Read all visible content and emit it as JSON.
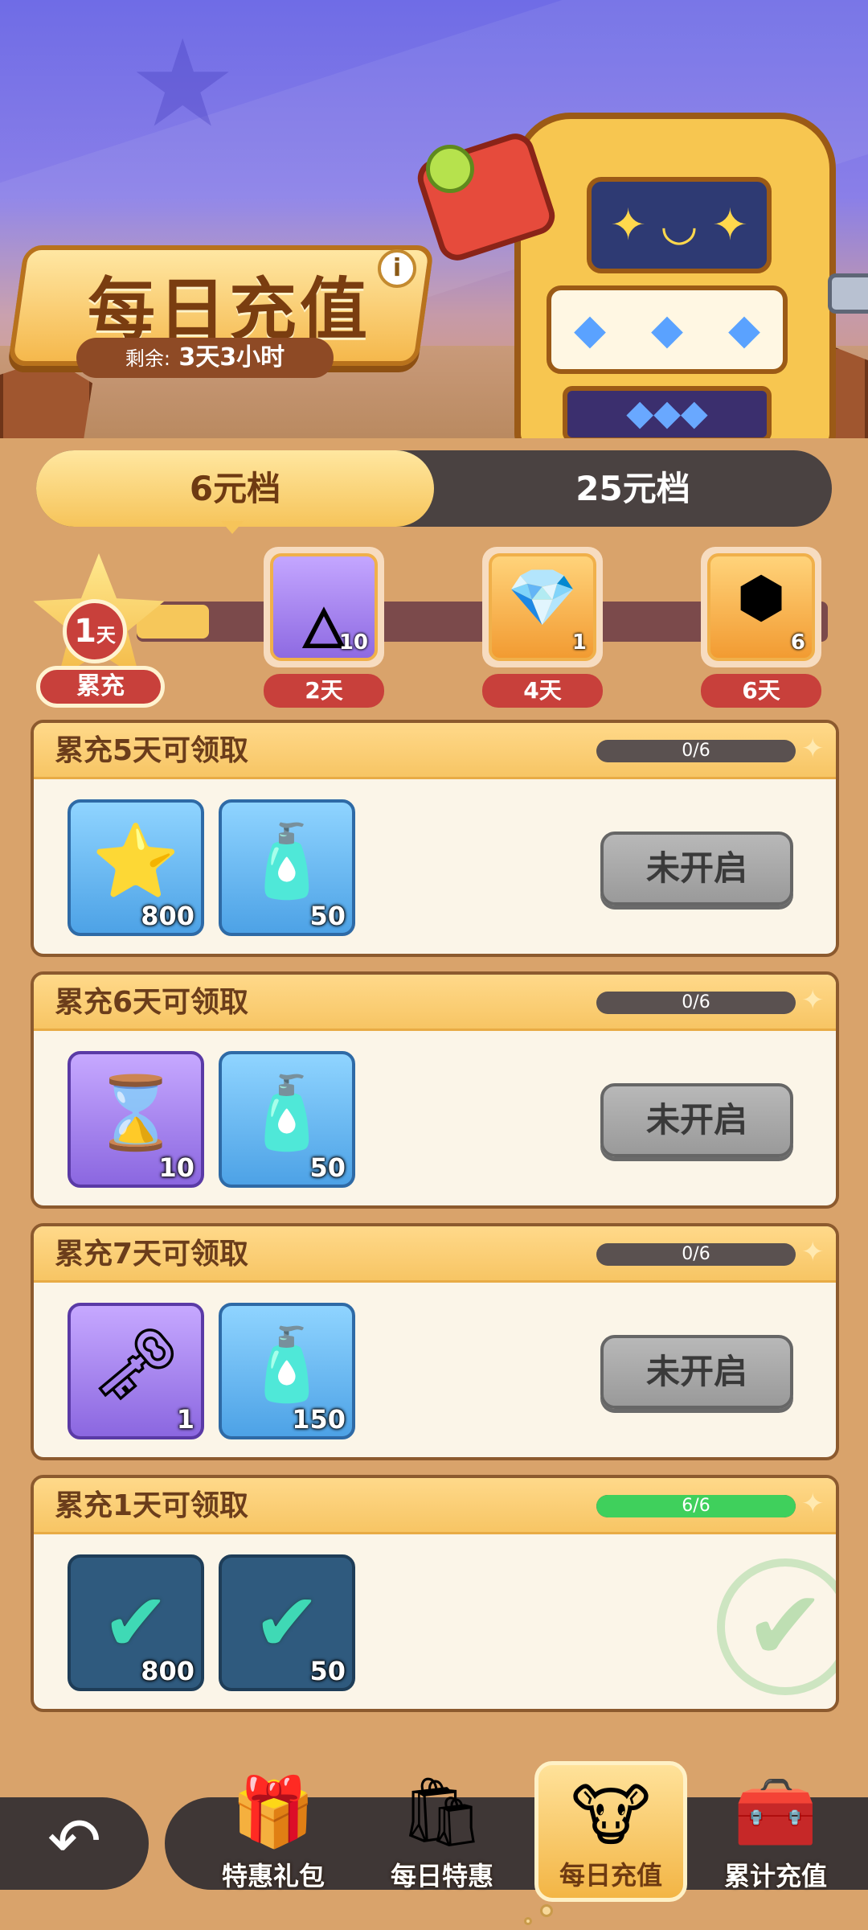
{
  "banner": {
    "title": "每日充值",
    "remaining_label": "剩余:",
    "remaining_value": "3天3小时",
    "info_icon": "i",
    "slot_screen": "✦ ◡ ✦",
    "slot_reels": [
      "◆",
      "◆",
      "◆"
    ],
    "slot_tray": "◆◆◆"
  },
  "tiers": {
    "active": "6元档",
    "inactive": "25元档"
  },
  "progress": {
    "current_day_number": "1",
    "current_day_unit": "天",
    "badge_label": "累充",
    "fill_fraction": 0.0,
    "milestones": [
      {
        "day": "2天",
        "count": "10",
        "icon": "blue-spirit-ring-icon",
        "glyph": "🜂",
        "style": "purple"
      },
      {
        "day": "4天",
        "count": "1",
        "icon": "crystal-ring-icon",
        "glyph": "💎",
        "style": "gold"
      },
      {
        "day": "6天",
        "count": "6",
        "icon": "rainbow-cube-icon",
        "glyph": "⬢",
        "style": "gold"
      }
    ]
  },
  "tasks": [
    {
      "title": "累充5天可领取",
      "progress_text": "0/6",
      "progress_fraction": 0.0,
      "status": "locked",
      "button": "未开启",
      "items": [
        {
          "icon": "gold-coin-icon",
          "glyph": "⭐",
          "count": "800",
          "style": "blue"
        },
        {
          "icon": "mystery-bottle-icon",
          "glyph": "🧴",
          "count": "50",
          "style": "blue"
        }
      ]
    },
    {
      "title": "累充6天可领取",
      "progress_text": "0/6",
      "progress_fraction": 0.0,
      "status": "locked",
      "button": "未开启",
      "items": [
        {
          "icon": "hourglass-icon",
          "glyph": "⌛",
          "count": "10",
          "style": "purple"
        },
        {
          "icon": "mystery-bottle-icon",
          "glyph": "🧴",
          "count": "50",
          "style": "blue"
        }
      ]
    },
    {
      "title": "累充7天可领取",
      "progress_text": "0/6",
      "progress_fraction": 0.0,
      "status": "locked",
      "button": "未开启",
      "items": [
        {
          "icon": "key-icon",
          "glyph": "🗝",
          "count": "1",
          "style": "purple"
        },
        {
          "icon": "mystery-bottle-icon",
          "glyph": "🧴",
          "count": "150",
          "style": "blue"
        }
      ]
    },
    {
      "title": "累充1天可领取",
      "progress_text": "6/6",
      "progress_fraction": 1.0,
      "status": "claimed",
      "button": "",
      "items": [
        {
          "icon": "gold-coin-icon",
          "glyph": "✔",
          "count": "800",
          "style": "dark"
        },
        {
          "icon": "mystery-bottle-icon",
          "glyph": "✔",
          "count": "50",
          "style": "dark"
        }
      ]
    }
  ],
  "nav": {
    "back_icon": "↶",
    "items": [
      {
        "label": "特惠礼包",
        "icon": "gift-box-icon",
        "glyph": "🎁",
        "active": false
      },
      {
        "label": "每日特惠",
        "icon": "gift-bag-icon",
        "glyph": "🛍",
        "active": false
      },
      {
        "label": "每日充值",
        "icon": "cow-mascot-icon",
        "glyph": "🐮",
        "active": true
      },
      {
        "label": "累计充值",
        "icon": "treasure-chest-icon",
        "glyph": "🧰",
        "active": false
      }
    ]
  },
  "colors": {
    "accent_gold": "#f6c45a",
    "badge_red": "#c8403b",
    "progress_green": "#3fd05c",
    "locked_gray": "#a8a8a8"
  }
}
